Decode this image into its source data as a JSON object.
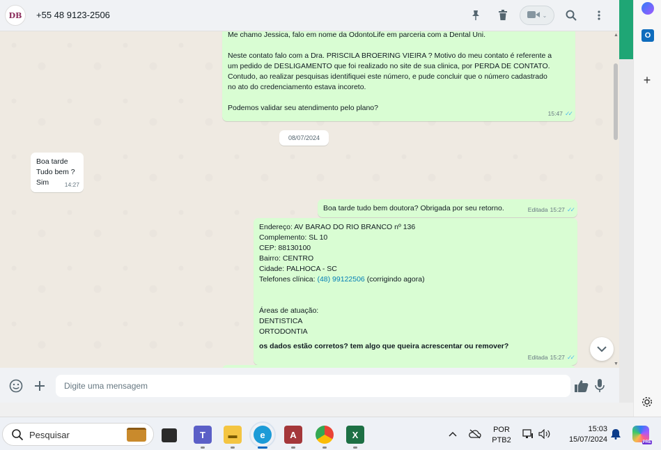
{
  "header": {
    "avatar_text": "DB",
    "contact": "+55 48 9123-2506",
    "icons": [
      "pin-icon",
      "trash-icon",
      "video-icon",
      "search-icon",
      "menu-icon"
    ]
  },
  "messages": {
    "m1": {
      "lines": [
        "Me chamo Jessica, falo em nome da OdontoLife em parceria com a Dental Uni.",
        "",
        "Neste contato falo com a Dra. PRISCILA BROERING VIEIRA ? Motivo do meu contato é referente a",
        "um pedido de DESLIGAMENTO que foi realizado no site de sua clinica, por PERDA DE CONTATO.",
        "Contudo, ao realizar pesquisas identifiquei este número, e pude concluir que o número cadastrado",
        "no ato do credenciamento estava incoreto.",
        "",
        "Podemos validar seu atendimento pelo plano?"
      ],
      "time": "15:47"
    },
    "date_chip": "08/07/2024",
    "m2": {
      "lines": [
        "Boa tarde",
        "Tudo bem ?",
        "Sim"
      ],
      "time": "14:27"
    },
    "m3": {
      "text": "Boa tarde tudo bem doutora? Obrigada por seu retorno.",
      "edited": "Editada",
      "time": "15:27"
    },
    "m4": {
      "l1": "Endereço: AV BARAO DO RIO BRANCO nº 136",
      "l2": "Complemento: SL 10",
      "l3": "CEP: 88130100",
      "l4": "Bairro: CENTRO",
      "l5": "Cidade: PALHOCA - SC",
      "phone_prefix": "Telefones clínica: ",
      "phone_link": "(48) 99122506",
      "phone_suffix": " (corrigindo agora)",
      "l7": "Áreas de atuação:",
      "l8": "DENTISTICA",
      "l9": "ORTODONTIA",
      "question": "os dados estão corretos? tem algo que queira acrescentar ou remover?",
      "edited": "Editada",
      "time": "15:27"
    }
  },
  "composer": {
    "placeholder": "Digite uma mensagem"
  },
  "taskbar": {
    "search_label": "Pesquisar",
    "lang_top": "POR",
    "lang_bottom": "PTB2",
    "time": "15:03",
    "date": "15/07/2024",
    "copilot_badge": "PRE"
  },
  "colors": {
    "outgoing_bubble": "#d9fdd3",
    "incoming_bubble": "#ffffff",
    "chat_bg": "#efeae2",
    "read_ticks": "#53bdeb",
    "link": "#027eb5"
  }
}
